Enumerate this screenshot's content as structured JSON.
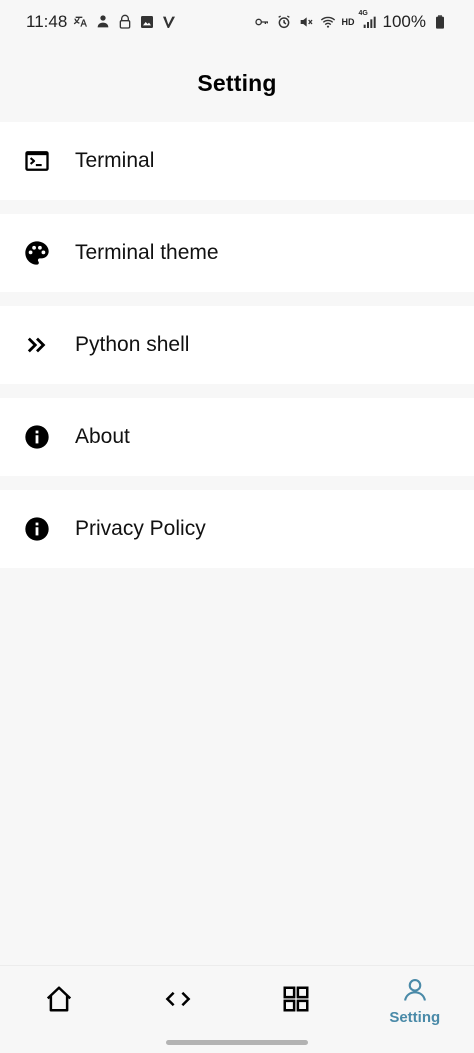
{
  "status_bar": {
    "time": "11:48",
    "battery": "100%",
    "network": "4G",
    "hd": "HD"
  },
  "header": {
    "title": "Setting"
  },
  "settings": {
    "items": [
      {
        "label": "Terminal",
        "icon": "terminal-icon"
      },
      {
        "label": "Terminal theme",
        "icon": "palette-icon"
      },
      {
        "label": "Python shell",
        "icon": "double-chevron-right-icon"
      },
      {
        "label": "About",
        "icon": "info-icon"
      },
      {
        "label": "Privacy Policy",
        "icon": "info-icon"
      }
    ]
  },
  "bottom_nav": {
    "items": [
      {
        "icon": "home-icon",
        "label": ""
      },
      {
        "icon": "code-icon",
        "label": ""
      },
      {
        "icon": "grid-icon",
        "label": ""
      },
      {
        "icon": "user-icon",
        "label": "Setting",
        "active": true
      }
    ],
    "active_color": "#4a8aa8"
  }
}
